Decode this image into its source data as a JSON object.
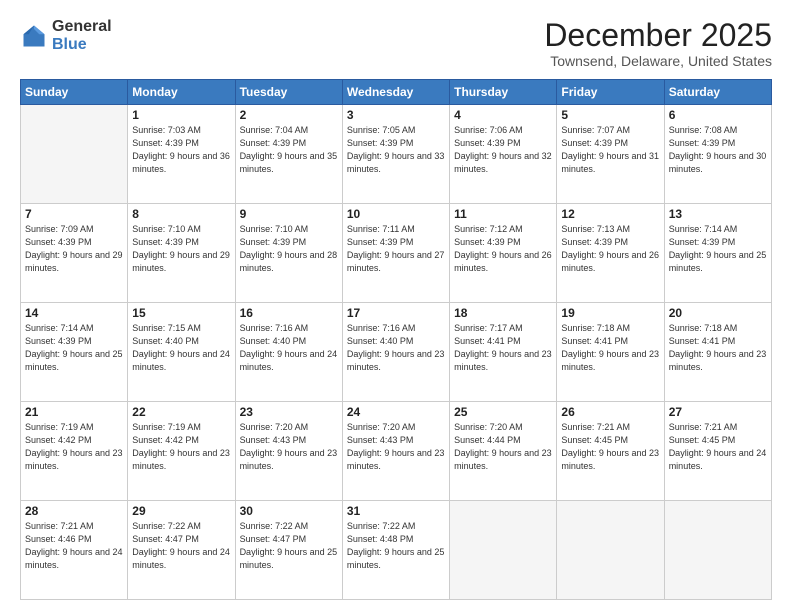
{
  "logo": {
    "general": "General",
    "blue": "Blue"
  },
  "title": {
    "month": "December 2025",
    "location": "Townsend, Delaware, United States"
  },
  "weekdays": [
    "Sunday",
    "Monday",
    "Tuesday",
    "Wednesday",
    "Thursday",
    "Friday",
    "Saturday"
  ],
  "weeks": [
    [
      {
        "day": "",
        "sunrise": "",
        "sunset": "",
        "daylight": ""
      },
      {
        "day": "1",
        "sunrise": "Sunrise: 7:03 AM",
        "sunset": "Sunset: 4:39 PM",
        "daylight": "Daylight: 9 hours and 36 minutes."
      },
      {
        "day": "2",
        "sunrise": "Sunrise: 7:04 AM",
        "sunset": "Sunset: 4:39 PM",
        "daylight": "Daylight: 9 hours and 35 minutes."
      },
      {
        "day": "3",
        "sunrise": "Sunrise: 7:05 AM",
        "sunset": "Sunset: 4:39 PM",
        "daylight": "Daylight: 9 hours and 33 minutes."
      },
      {
        "day": "4",
        "sunrise": "Sunrise: 7:06 AM",
        "sunset": "Sunset: 4:39 PM",
        "daylight": "Daylight: 9 hours and 32 minutes."
      },
      {
        "day": "5",
        "sunrise": "Sunrise: 7:07 AM",
        "sunset": "Sunset: 4:39 PM",
        "daylight": "Daylight: 9 hours and 31 minutes."
      },
      {
        "day": "6",
        "sunrise": "Sunrise: 7:08 AM",
        "sunset": "Sunset: 4:39 PM",
        "daylight": "Daylight: 9 hours and 30 minutes."
      }
    ],
    [
      {
        "day": "7",
        "sunrise": "Sunrise: 7:09 AM",
        "sunset": "Sunset: 4:39 PM",
        "daylight": "Daylight: 9 hours and 29 minutes."
      },
      {
        "day": "8",
        "sunrise": "Sunrise: 7:10 AM",
        "sunset": "Sunset: 4:39 PM",
        "daylight": "Daylight: 9 hours and 29 minutes."
      },
      {
        "day": "9",
        "sunrise": "Sunrise: 7:10 AM",
        "sunset": "Sunset: 4:39 PM",
        "daylight": "Daylight: 9 hours and 28 minutes."
      },
      {
        "day": "10",
        "sunrise": "Sunrise: 7:11 AM",
        "sunset": "Sunset: 4:39 PM",
        "daylight": "Daylight: 9 hours and 27 minutes."
      },
      {
        "day": "11",
        "sunrise": "Sunrise: 7:12 AM",
        "sunset": "Sunset: 4:39 PM",
        "daylight": "Daylight: 9 hours and 26 minutes."
      },
      {
        "day": "12",
        "sunrise": "Sunrise: 7:13 AM",
        "sunset": "Sunset: 4:39 PM",
        "daylight": "Daylight: 9 hours and 26 minutes."
      },
      {
        "day": "13",
        "sunrise": "Sunrise: 7:14 AM",
        "sunset": "Sunset: 4:39 PM",
        "daylight": "Daylight: 9 hours and 25 minutes."
      }
    ],
    [
      {
        "day": "14",
        "sunrise": "Sunrise: 7:14 AM",
        "sunset": "Sunset: 4:39 PM",
        "daylight": "Daylight: 9 hours and 25 minutes."
      },
      {
        "day": "15",
        "sunrise": "Sunrise: 7:15 AM",
        "sunset": "Sunset: 4:40 PM",
        "daylight": "Daylight: 9 hours and 24 minutes."
      },
      {
        "day": "16",
        "sunrise": "Sunrise: 7:16 AM",
        "sunset": "Sunset: 4:40 PM",
        "daylight": "Daylight: 9 hours and 24 minutes."
      },
      {
        "day": "17",
        "sunrise": "Sunrise: 7:16 AM",
        "sunset": "Sunset: 4:40 PM",
        "daylight": "Daylight: 9 hours and 23 minutes."
      },
      {
        "day": "18",
        "sunrise": "Sunrise: 7:17 AM",
        "sunset": "Sunset: 4:41 PM",
        "daylight": "Daylight: 9 hours and 23 minutes."
      },
      {
        "day": "19",
        "sunrise": "Sunrise: 7:18 AM",
        "sunset": "Sunset: 4:41 PM",
        "daylight": "Daylight: 9 hours and 23 minutes."
      },
      {
        "day": "20",
        "sunrise": "Sunrise: 7:18 AM",
        "sunset": "Sunset: 4:41 PM",
        "daylight": "Daylight: 9 hours and 23 minutes."
      }
    ],
    [
      {
        "day": "21",
        "sunrise": "Sunrise: 7:19 AM",
        "sunset": "Sunset: 4:42 PM",
        "daylight": "Daylight: 9 hours and 23 minutes."
      },
      {
        "day": "22",
        "sunrise": "Sunrise: 7:19 AM",
        "sunset": "Sunset: 4:42 PM",
        "daylight": "Daylight: 9 hours and 23 minutes."
      },
      {
        "day": "23",
        "sunrise": "Sunrise: 7:20 AM",
        "sunset": "Sunset: 4:43 PM",
        "daylight": "Daylight: 9 hours and 23 minutes."
      },
      {
        "day": "24",
        "sunrise": "Sunrise: 7:20 AM",
        "sunset": "Sunset: 4:43 PM",
        "daylight": "Daylight: 9 hours and 23 minutes."
      },
      {
        "day": "25",
        "sunrise": "Sunrise: 7:20 AM",
        "sunset": "Sunset: 4:44 PM",
        "daylight": "Daylight: 9 hours and 23 minutes."
      },
      {
        "day": "26",
        "sunrise": "Sunrise: 7:21 AM",
        "sunset": "Sunset: 4:45 PM",
        "daylight": "Daylight: 9 hours and 23 minutes."
      },
      {
        "day": "27",
        "sunrise": "Sunrise: 7:21 AM",
        "sunset": "Sunset: 4:45 PM",
        "daylight": "Daylight: 9 hours and 24 minutes."
      }
    ],
    [
      {
        "day": "28",
        "sunrise": "Sunrise: 7:21 AM",
        "sunset": "Sunset: 4:46 PM",
        "daylight": "Daylight: 9 hours and 24 minutes."
      },
      {
        "day": "29",
        "sunrise": "Sunrise: 7:22 AM",
        "sunset": "Sunset: 4:47 PM",
        "daylight": "Daylight: 9 hours and 24 minutes."
      },
      {
        "day": "30",
        "sunrise": "Sunrise: 7:22 AM",
        "sunset": "Sunset: 4:47 PM",
        "daylight": "Daylight: 9 hours and 25 minutes."
      },
      {
        "day": "31",
        "sunrise": "Sunrise: 7:22 AM",
        "sunset": "Sunset: 4:48 PM",
        "daylight": "Daylight: 9 hours and 25 minutes."
      },
      {
        "day": "",
        "sunrise": "",
        "sunset": "",
        "daylight": ""
      },
      {
        "day": "",
        "sunrise": "",
        "sunset": "",
        "daylight": ""
      },
      {
        "day": "",
        "sunrise": "",
        "sunset": "",
        "daylight": ""
      }
    ]
  ]
}
